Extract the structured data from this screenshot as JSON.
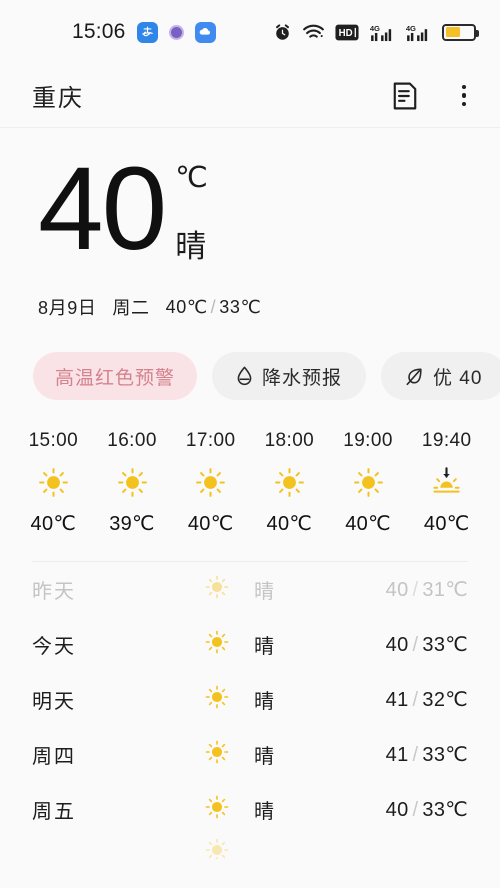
{
  "status_bar": {
    "clock": "15:06",
    "left_icons": [
      "alipay-icon",
      "purple-dot-icon",
      "cloud-app-icon"
    ],
    "right_icons": [
      "alarm-icon",
      "wifi-icon",
      "hd-voice-icon",
      "signal-4g-icon-1",
      "signal-4g-icon-2",
      "battery-icon"
    ],
    "battery_level_percent": 55,
    "battery_color": "#f5bf2a",
    "hd_label": "HD"
  },
  "app_bar": {
    "city": "重庆",
    "actions": [
      "report-icon",
      "overflow-menu-icon"
    ]
  },
  "current": {
    "temperature": "40",
    "unit": "℃",
    "condition": "晴",
    "date": "8月9日",
    "weekday": "周二",
    "high": "40℃",
    "low": "33℃",
    "slash": "/"
  },
  "chips": [
    {
      "label": "高温红色预警",
      "icon": null,
      "style": "warning"
    },
    {
      "label": "降水预报",
      "icon": "droplet-icon",
      "style": "normal"
    },
    {
      "label": "优 40",
      "icon": "leaf-aqi-icon",
      "style": "normal"
    }
  ],
  "chip_colors": {
    "warning_bg": "#fae3e6",
    "warning_text": "#d4828d",
    "normal_bg": "#f0f0f0",
    "normal_text": "#2a2a2a"
  },
  "hourly": [
    {
      "time": "15:00",
      "icon": "sunny-icon",
      "temp": "40℃"
    },
    {
      "time": "16:00",
      "icon": "sunny-icon",
      "temp": "39℃"
    },
    {
      "time": "17:00",
      "icon": "sunny-icon",
      "temp": "40℃"
    },
    {
      "time": "18:00",
      "icon": "sunny-icon",
      "temp": "40℃"
    },
    {
      "time": "19:00",
      "icon": "sunny-icon",
      "temp": "40℃"
    },
    {
      "time": "19:40",
      "icon": "sunset-icon",
      "temp": "40℃"
    }
  ],
  "daily": [
    {
      "day": "昨天",
      "icon": "sunny-icon",
      "condition": "晴",
      "high": "40",
      "low": "31℃",
      "slash": "/",
      "past": true
    },
    {
      "day": "今天",
      "icon": "sunny-icon",
      "condition": "晴",
      "high": "40",
      "low": "33℃",
      "slash": "/",
      "past": false
    },
    {
      "day": "明天",
      "icon": "sunny-icon",
      "condition": "晴",
      "high": "41",
      "low": "32℃",
      "slash": "/",
      "past": false
    },
    {
      "day": "周四",
      "icon": "sunny-icon",
      "condition": "晴",
      "high": "41",
      "low": "33℃",
      "slash": "/",
      "past": false
    },
    {
      "day": "周五",
      "icon": "sunny-icon",
      "condition": "晴",
      "high": "40",
      "low": "33℃",
      "slash": "/",
      "past": false
    }
  ],
  "theme": {
    "page_bg": "#fafafa",
    "sun_color": "#f4c21f",
    "text_primary": "#1b1b1b",
    "text_muted": "#c4c4c4"
  }
}
